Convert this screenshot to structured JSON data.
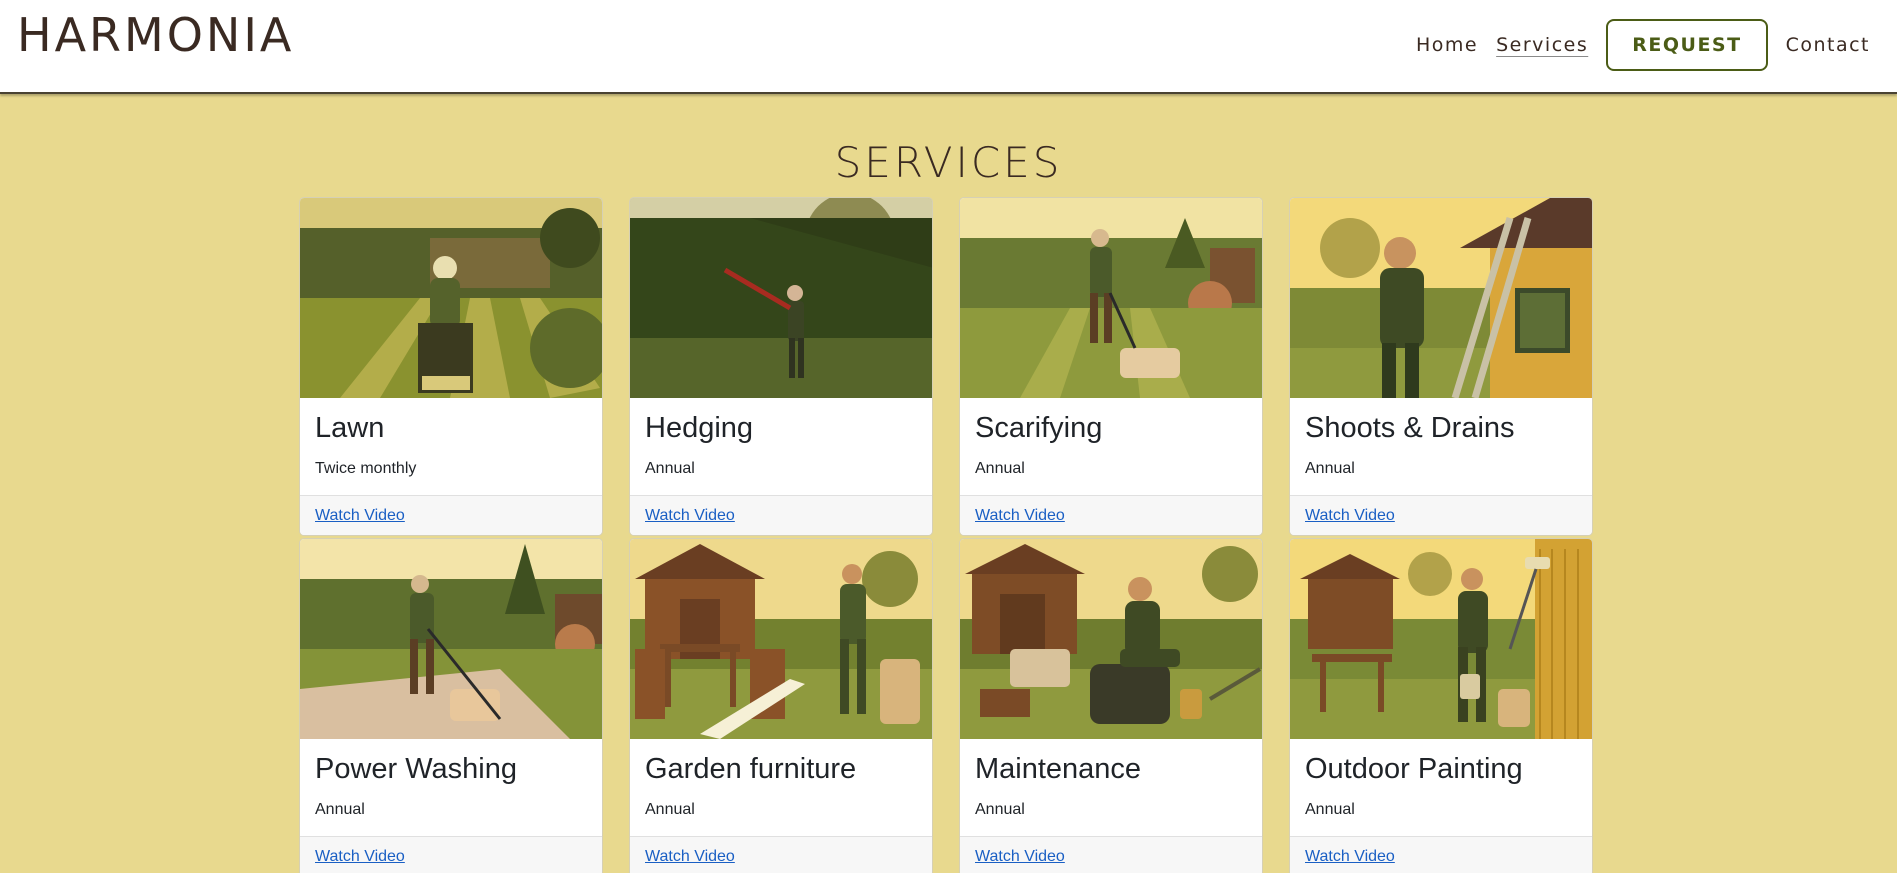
{
  "header": {
    "logo": "HARMONIA",
    "nav": {
      "home": "Home",
      "services": "Services",
      "request": "REQUEST",
      "contact": "Contact"
    }
  },
  "main": {
    "title": "SERVICES",
    "cards": [
      {
        "title": "Lawn",
        "frequency": "Twice monthly",
        "link": "Watch Video"
      },
      {
        "title": "Hedging",
        "frequency": "Annual",
        "link": "Watch Video"
      },
      {
        "title": "Scarifying",
        "frequency": "Annual",
        "link": "Watch Video"
      },
      {
        "title": "Shoots & Drains",
        "frequency": "Annual",
        "link": "Watch Video"
      },
      {
        "title": "Power Washing",
        "frequency": "Annual",
        "link": "Watch Video"
      },
      {
        "title": "Garden furniture",
        "frequency": "Annual",
        "link": "Watch Video"
      },
      {
        "title": "Maintenance",
        "frequency": "Annual",
        "link": "Watch Video"
      },
      {
        "title": "Outdoor Painting",
        "frequency": "Annual",
        "link": "Watch Video"
      }
    ]
  },
  "colors": {
    "page_background": "#e8d98e",
    "accent_green": "#4b5c16",
    "link_blue": "#1a5fc4",
    "text_dark": "#3a2a22"
  }
}
